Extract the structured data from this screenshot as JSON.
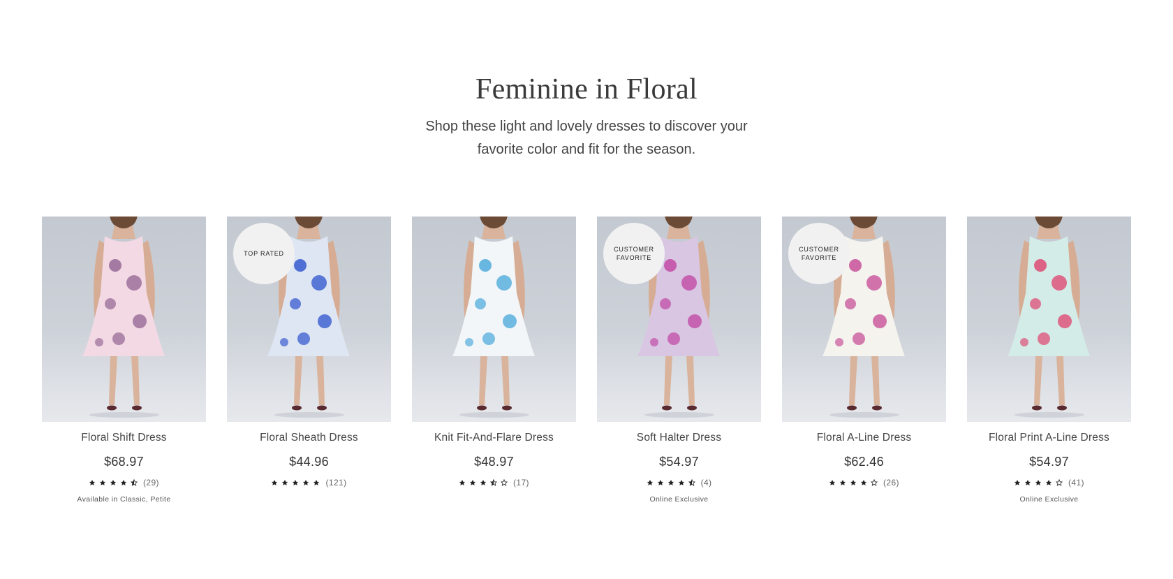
{
  "section": {
    "title": "Feminine in Floral",
    "subtitle": "Shop these light and lovely dresses to discover your favorite color and fit for the season."
  },
  "colors": {
    "image_bg": "#c8cdd4",
    "badge_bg": "#f1f1f2",
    "star": "#222222"
  },
  "products": [
    {
      "name": "Floral Shift Dress",
      "price": "$68.97",
      "rating": 4.5,
      "rating_count": "(29)",
      "badge": "",
      "note": "Available in Classic, Petite",
      "dress_color": "#f3d9e4",
      "print_color": "#8a5a8c",
      "image_icon": "dress-photo"
    },
    {
      "name": "Floral Sheath Dress",
      "price": "$44.96",
      "rating": 5,
      "rating_count": "(121)",
      "badge": "Top Rated",
      "note": "",
      "dress_color": "#dfe6f3",
      "print_color": "#1f47c9",
      "image_icon": "dress-photo"
    },
    {
      "name": "Knit Fit-And-Flare Dress",
      "price": "$48.97",
      "rating": 3.5,
      "rating_count": "(17)",
      "badge": "",
      "note": "",
      "dress_color": "#f2f6f8",
      "print_color": "#3aa1d8",
      "image_icon": "dress-photo"
    },
    {
      "name": "Soft Halter Dress",
      "price": "$54.97",
      "rating": 4.5,
      "rating_count": "(4)",
      "badge": "Customer Favorite",
      "note": "Online Exclusive",
      "dress_color": "#d8c6e2",
      "print_color": "#c03a9e",
      "image_icon": "dress-photo"
    },
    {
      "name": "Floral A-Line Dress",
      "price": "$62.46",
      "rating": 4,
      "rating_count": "(26)",
      "badge": "Customer Favorite",
      "note": "",
      "dress_color": "#f4f3ee",
      "print_color": "#c23a8e",
      "image_icon": "dress-photo"
    },
    {
      "name": "Floral Print A-Line Dress",
      "price": "$54.97",
      "rating": 4,
      "rating_count": "(41)",
      "badge": "",
      "note": "Online Exclusive",
      "dress_color": "#d4ece8",
      "print_color": "#e03565",
      "image_icon": "dress-photo"
    }
  ]
}
